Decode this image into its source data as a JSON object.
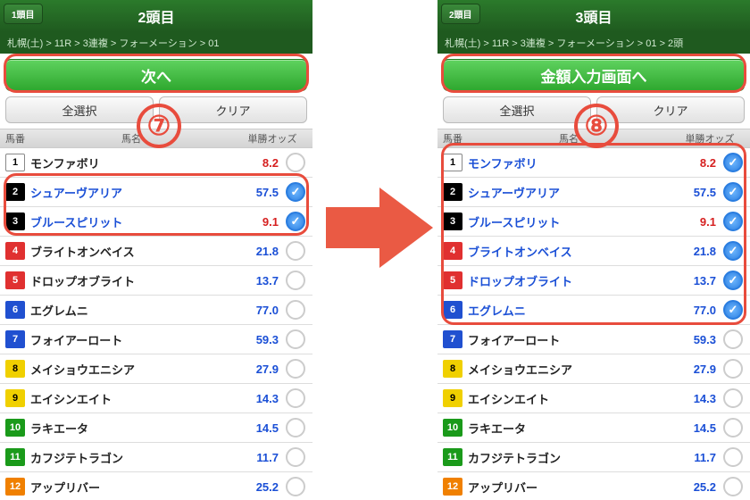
{
  "left": {
    "back_tab": "1頭目",
    "title": "2頭目",
    "crumb": "札幌(土) > 11R > 3連複 > フォーメーション > 01",
    "primary": "次へ",
    "select_all": "全選択",
    "clear": "クリア",
    "col_num": "馬番",
    "col_name": "馬名",
    "col_odds": "単勝オッズ",
    "step": "⑦",
    "horses": [
      {
        "n": "1",
        "cls": "n-white",
        "name": "モンファボリ",
        "odds": "8.2",
        "red": true,
        "sel": false
      },
      {
        "n": "2",
        "cls": "n-black",
        "name": "シュアーヴアリア",
        "odds": "57.5",
        "red": false,
        "sel": true
      },
      {
        "n": "3",
        "cls": "n-black",
        "name": "ブルースピリット",
        "odds": "9.1",
        "red": true,
        "sel": true
      },
      {
        "n": "4",
        "cls": "n-red",
        "name": "ブライトオンベイス",
        "odds": "21.8",
        "red": false,
        "sel": false
      },
      {
        "n": "5",
        "cls": "n-red",
        "name": "ドロップオブライト",
        "odds": "13.7",
        "red": false,
        "sel": false
      },
      {
        "n": "6",
        "cls": "n-blue",
        "name": "エグレムニ",
        "odds": "77.0",
        "red": false,
        "sel": false
      },
      {
        "n": "7",
        "cls": "n-blue",
        "name": "フォイアーロート",
        "odds": "59.3",
        "red": false,
        "sel": false
      },
      {
        "n": "8",
        "cls": "n-yellow",
        "name": "メイショウエニシア",
        "odds": "27.9",
        "red": false,
        "sel": false
      },
      {
        "n": "9",
        "cls": "n-yellow",
        "name": "エイシンエイト",
        "odds": "14.3",
        "red": false,
        "sel": false
      },
      {
        "n": "10",
        "cls": "n-green",
        "name": "ラキエータ",
        "odds": "14.5",
        "red": false,
        "sel": false
      },
      {
        "n": "11",
        "cls": "n-green",
        "name": "カフジテトラゴン",
        "odds": "11.7",
        "red": false,
        "sel": false
      },
      {
        "n": "12",
        "cls": "n-orange",
        "name": "アップリバー",
        "odds": "25.2",
        "red": false,
        "sel": false
      }
    ]
  },
  "right": {
    "back_tab": "2頭目",
    "title": "3頭目",
    "crumb": "札幌(土) > 11R > 3連複 > フォーメーション > 01 > 2頭",
    "primary": "金額入力画面へ",
    "select_all": "全選択",
    "clear": "クリア",
    "col_num": "馬番",
    "col_name": "馬名",
    "col_odds": "単勝オッズ",
    "step": "⑧",
    "horses": [
      {
        "n": "1",
        "cls": "n-white",
        "name": "モンファボリ",
        "odds": "8.2",
        "red": true,
        "sel": true
      },
      {
        "n": "2",
        "cls": "n-black",
        "name": "シュアーヴアリア",
        "odds": "57.5",
        "red": false,
        "sel": true
      },
      {
        "n": "3",
        "cls": "n-black",
        "name": "ブルースピリット",
        "odds": "9.1",
        "red": true,
        "sel": true
      },
      {
        "n": "4",
        "cls": "n-red",
        "name": "ブライトオンベイス",
        "odds": "21.8",
        "red": false,
        "sel": true
      },
      {
        "n": "5",
        "cls": "n-red",
        "name": "ドロップオブライト",
        "odds": "13.7",
        "red": false,
        "sel": true
      },
      {
        "n": "6",
        "cls": "n-blue",
        "name": "エグレムニ",
        "odds": "77.0",
        "red": false,
        "sel": true
      },
      {
        "n": "7",
        "cls": "n-blue",
        "name": "フォイアーロート",
        "odds": "59.3",
        "red": false,
        "sel": false
      },
      {
        "n": "8",
        "cls": "n-yellow",
        "name": "メイショウエニシア",
        "odds": "27.9",
        "red": false,
        "sel": false
      },
      {
        "n": "9",
        "cls": "n-yellow",
        "name": "エイシンエイト",
        "odds": "14.3",
        "red": false,
        "sel": false
      },
      {
        "n": "10",
        "cls": "n-green",
        "name": "ラキエータ",
        "odds": "14.5",
        "red": false,
        "sel": false
      },
      {
        "n": "11",
        "cls": "n-green",
        "name": "カフジテトラゴン",
        "odds": "11.7",
        "red": false,
        "sel": false
      },
      {
        "n": "12",
        "cls": "n-orange",
        "name": "アップリバー",
        "odds": "25.2",
        "red": false,
        "sel": false
      }
    ]
  }
}
